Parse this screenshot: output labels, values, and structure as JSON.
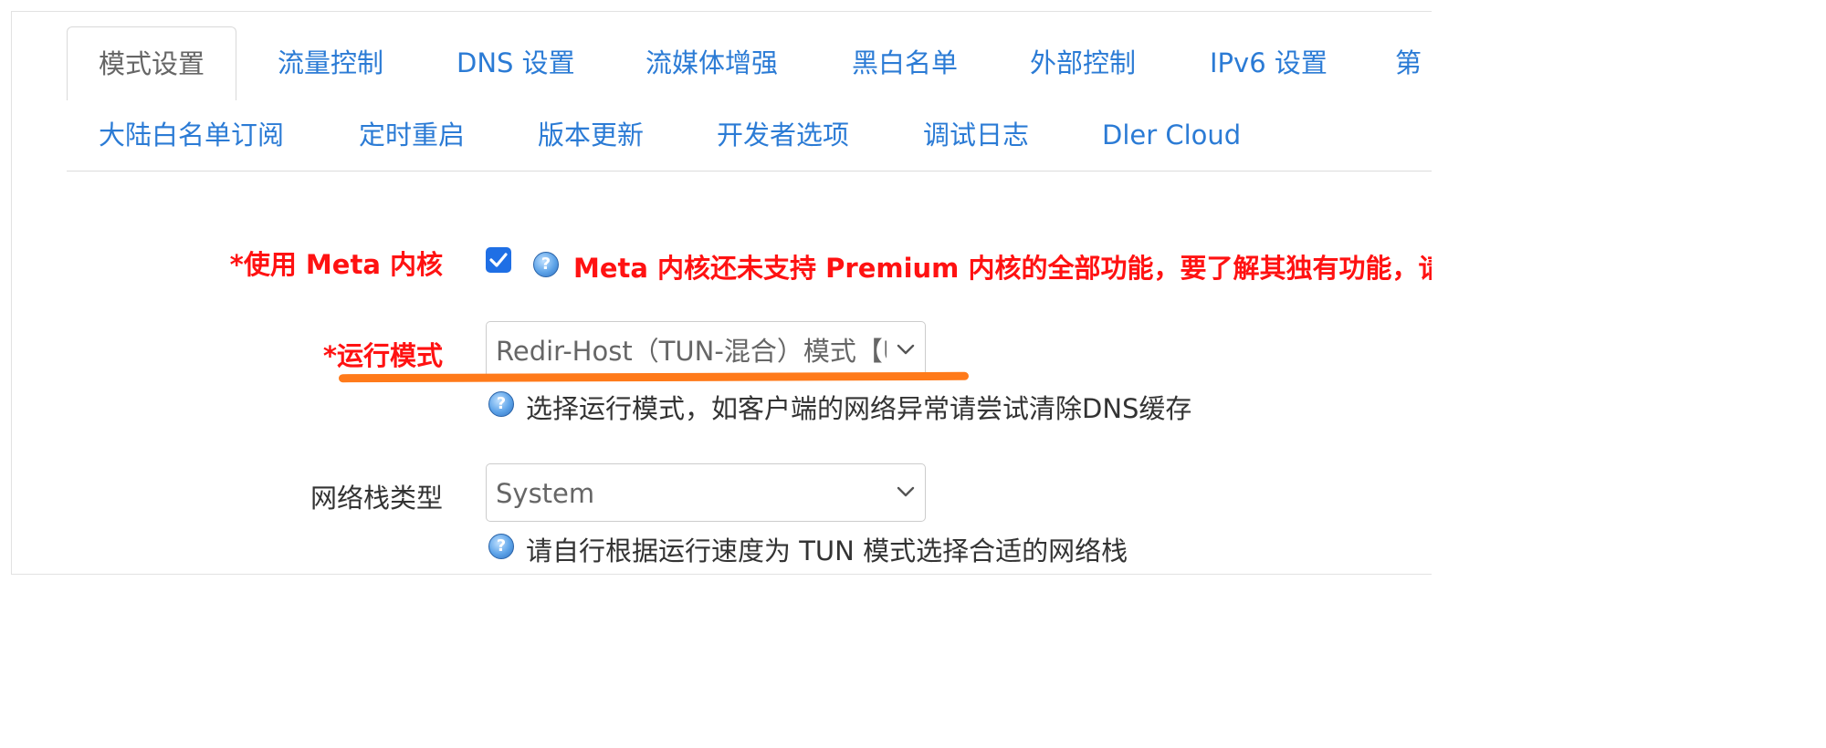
{
  "tabs_row1": [
    "模式设置",
    "流量控制",
    "DNS 设置",
    "流媒体增强",
    "黑白名单",
    "外部控制",
    "IPv6 设置",
    "第"
  ],
  "tabs_row2": [
    "大陆白名单订阅",
    "定时重启",
    "版本更新",
    "开发者选项",
    "调试日志",
    "Dler Cloud"
  ],
  "active_tab": "模式设置",
  "form": {
    "meta_core": {
      "label": "*使用 Meta 内核",
      "checked": true,
      "warning": "Meta 内核还未支持 Premium 内核的全部功能，要了解其独有功能，请"
    },
    "run_mode": {
      "label": "*运行模式",
      "value": "Redir-Host（TUN-混合）模式【U",
      "hint": "选择运行模式，如客户端的网络异常请尝试清除DNS缓存"
    },
    "stack_type": {
      "label": "网络栈类型",
      "value": "System",
      "hint": "请自行根据运行速度为 TUN 模式选择合适的网络栈"
    }
  },
  "colors": {
    "tab_link": "#2b7bd5",
    "required_red": "#ff1212",
    "annotation_orange": "#ff7a1a",
    "checkbox_blue": "#1f6fe5"
  },
  "icons": [
    "help-icon",
    "check-icon",
    "chevron-down-icon"
  ]
}
